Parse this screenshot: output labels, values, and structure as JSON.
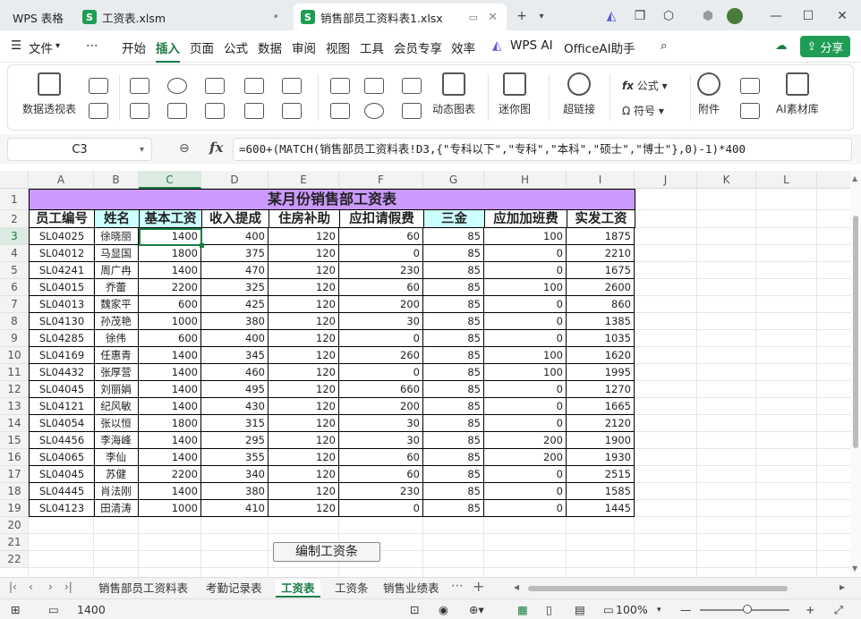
{
  "titlebar": {
    "app_tab": "WPS 表格",
    "tabs": [
      {
        "label": "工资表.xlsm",
        "icon": "S"
      },
      {
        "label": "销售部员工资料表1.xlsx",
        "icon": "S"
      }
    ],
    "new_tab": "+"
  },
  "menu": {
    "file": "文件",
    "items": [
      "开始",
      "插入",
      "页面",
      "公式",
      "数据",
      "审阅",
      "视图",
      "工具",
      "会员专享",
      "效率"
    ],
    "active": "插入",
    "wps_ai": "WPS AI",
    "office_ai": "OfficeAI助手",
    "share": "分享"
  },
  "ribbon": {
    "pivot": "数据透视表",
    "dynamic_chart": "动态图表",
    "sparkline": "迷你图",
    "hyperlink": "超链接",
    "formula": "公式",
    "symbol": "符号",
    "attachment": "附件",
    "ai_assets": "AI素材库"
  },
  "formula_bar": {
    "cell_ref": "C3",
    "fx": "fx",
    "formula": "=600+(MATCH(销售部员工资料表!D3,{\"专科以下\",\"专科\",\"本科\",\"硕士\",\"博士\"},0)-1)*400"
  },
  "grid": {
    "columns": [
      "A",
      "B",
      "C",
      "D",
      "E",
      "F",
      "G",
      "H",
      "I",
      "J",
      "K",
      "L"
    ],
    "selected_column": "C",
    "rows": [
      "1",
      "2",
      "3",
      "4",
      "5",
      "6",
      "7",
      "8",
      "9",
      "10",
      "11",
      "12",
      "13",
      "14",
      "15",
      "16",
      "17",
      "18",
      "19",
      "20",
      "21",
      "22"
    ],
    "selected_row": "3",
    "title": "某月份销售部工资表",
    "headers": [
      "员工编号",
      "姓名",
      "基本工资",
      "收入提成",
      "住房补助",
      "应扣请假费",
      "三金",
      "应加加班费",
      "实发工资"
    ],
    "data": [
      [
        "SL04025",
        "徐晓丽",
        "1400",
        "400",
        "120",
        "60",
        "85",
        "100",
        "1875"
      ],
      [
        "SL04012",
        "马显国",
        "1800",
        "375",
        "120",
        "0",
        "85",
        "0",
        "2210"
      ],
      [
        "SL04241",
        "周广冉",
        "1400",
        "470",
        "120",
        "230",
        "85",
        "0",
        "1675"
      ],
      [
        "SL04015",
        "乔蕾",
        "2200",
        "325",
        "120",
        "60",
        "85",
        "100",
        "2600"
      ],
      [
        "SL04013",
        "魏家平",
        "600",
        "425",
        "120",
        "200",
        "85",
        "0",
        "860"
      ],
      [
        "SL04130",
        "孙茂艳",
        "1000",
        "380",
        "120",
        "30",
        "85",
        "0",
        "1385"
      ],
      [
        "SL04285",
        "徐伟",
        "600",
        "400",
        "120",
        "0",
        "85",
        "0",
        "1035"
      ],
      [
        "SL04169",
        "任惠青",
        "1400",
        "345",
        "120",
        "260",
        "85",
        "100",
        "1620"
      ],
      [
        "SL04432",
        "张厚营",
        "1400",
        "460",
        "120",
        "0",
        "85",
        "100",
        "1995"
      ],
      [
        "SL04045",
        "刘丽娟",
        "1400",
        "495",
        "120",
        "660",
        "85",
        "0",
        "1270"
      ],
      [
        "SL04121",
        "纪风敏",
        "1400",
        "430",
        "120",
        "200",
        "85",
        "0",
        "1665"
      ],
      [
        "SL04054",
        "张以恒",
        "1800",
        "315",
        "120",
        "30",
        "85",
        "0",
        "2120"
      ],
      [
        "SL04456",
        "李海峰",
        "1400",
        "295",
        "120",
        "30",
        "85",
        "200",
        "1900"
      ],
      [
        "SL04065",
        "李仙",
        "1400",
        "355",
        "120",
        "60",
        "85",
        "200",
        "1930"
      ],
      [
        "SL04045",
        "苏健",
        "2200",
        "340",
        "120",
        "60",
        "85",
        "0",
        "2515"
      ],
      [
        "SL04445",
        "肖法刚",
        "1400",
        "380",
        "120",
        "230",
        "85",
        "0",
        "1585"
      ],
      [
        "SL04123",
        "田清涛",
        "1000",
        "410",
        "120",
        "0",
        "85",
        "0",
        "1445"
      ]
    ],
    "button": "编制工资条"
  },
  "sheets": {
    "tabs": [
      "销售部员工资料表",
      "考勤记录表",
      "工资表",
      "工资条",
      "销售业绩表"
    ],
    "active": "工资表"
  },
  "status": {
    "cell_value": "1400",
    "zoom": "100%"
  }
}
